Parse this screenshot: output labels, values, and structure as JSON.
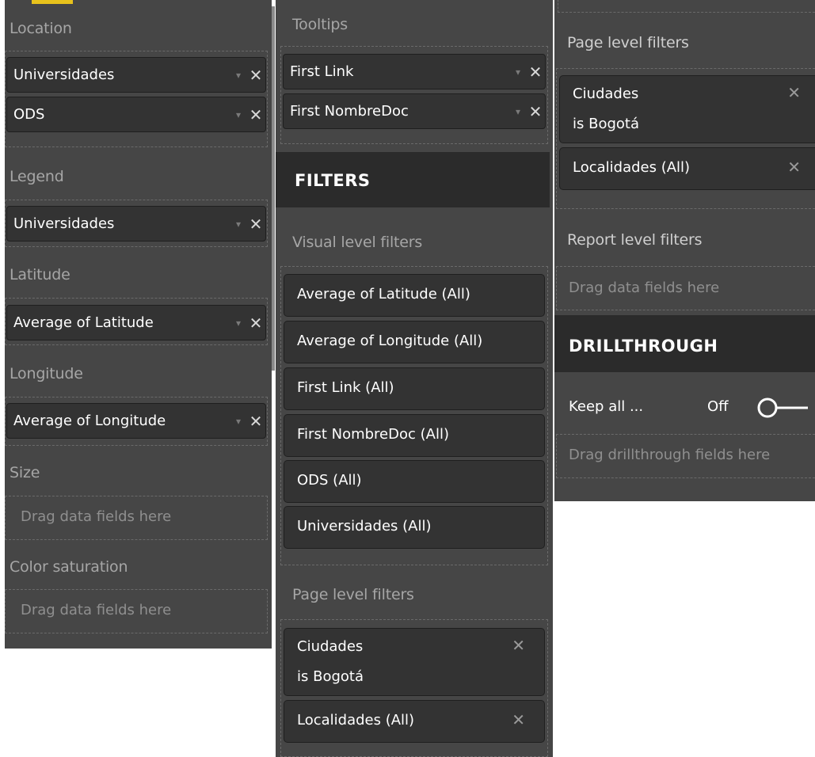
{
  "colors": {
    "panel_bg": "#464646",
    "pill_bg": "#333333",
    "header_bg": "#2b2b2b",
    "accent": "#e8c21c",
    "text": "#ffffff",
    "muted_text": "#a6a6a6"
  },
  "fields_pane": {
    "location": {
      "label": "Location",
      "items": [
        "Universidades",
        "ODS"
      ]
    },
    "legend": {
      "label": "Legend",
      "items": [
        "Universidades"
      ]
    },
    "latitude": {
      "label": "Latitude",
      "items": [
        "Average of Latitude"
      ]
    },
    "longitude": {
      "label": "Longitude",
      "items": [
        "Average of Longitude"
      ]
    },
    "size": {
      "label": "Size",
      "placeholder": "Drag data fields here"
    },
    "color_saturation": {
      "label": "Color saturation",
      "placeholder": "Drag data fields here"
    }
  },
  "middle_pane": {
    "tooltips": {
      "label": "Tooltips",
      "items": [
        "First Link",
        "First NombreDoc"
      ]
    },
    "filters_header": "FILTERS",
    "visual_level": {
      "label": "Visual level filters",
      "items": [
        "Average of Latitude (All)",
        "Average of Longitude (All)",
        "First Link (All)",
        "First NombreDoc (All)",
        "ODS (All)",
        "Universidades (All)"
      ]
    },
    "page_level": {
      "label": "Page level filters",
      "ciudades_line1": "Ciudades",
      "ciudades_line2": "is Bogotá",
      "localidades": "Localidades (All)"
    }
  },
  "right_pane": {
    "page_level": {
      "label": "Page level filters",
      "ciudades_line1": "Ciudades",
      "ciudades_line2": "is Bogotá",
      "localidades": "Localidades (All)"
    },
    "report_level": {
      "label": "Report level filters",
      "placeholder": "Drag data fields here"
    },
    "drillthrough_header": "DRILLTHROUGH",
    "keep_all": {
      "label": "Keep all ...",
      "state": "Off"
    },
    "drillthrough_placeholder": "Drag drillthrough fields here"
  },
  "icons": {
    "remove": "✕",
    "dropdown": "▾"
  }
}
